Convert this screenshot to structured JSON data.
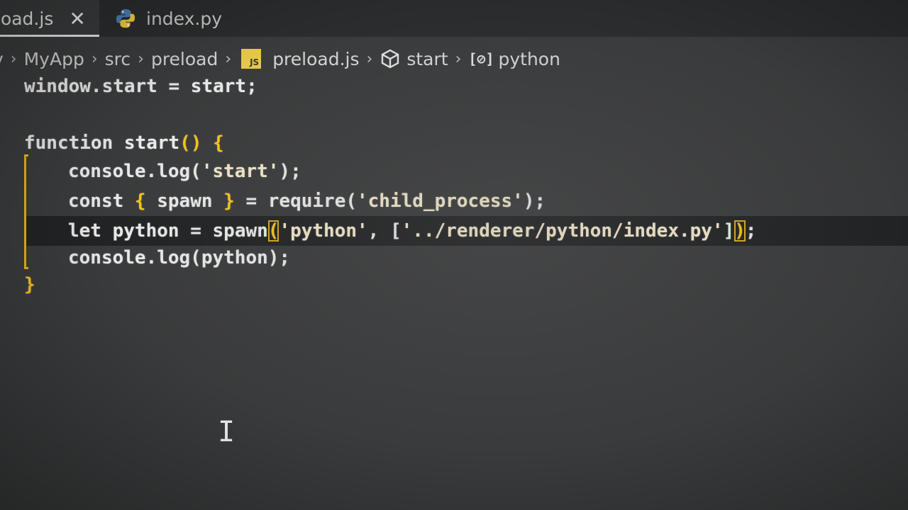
{
  "tabs": [
    {
      "label": "load.js",
      "active": true,
      "icon": "close-icon",
      "close_glyph": "✕"
    },
    {
      "label": "index.py",
      "active": false,
      "icon": "python-icon"
    }
  ],
  "breadcrumb": {
    "items": [
      "v",
      "MyApp",
      "src",
      "preload",
      "preload.js",
      "start",
      "python"
    ],
    "separator": "›",
    "js_badge": "JS",
    "var_glyph": "[⊘]"
  },
  "code": {
    "line1": {
      "a": "window.start = start;"
    },
    "line3": {
      "kw": "function ",
      "name": "start",
      "parens": "()",
      "space": " ",
      "brace": "{"
    },
    "line4": {
      "a": "console.log(",
      "str": "'start'",
      "b": ");"
    },
    "line5": {
      "kw": "const ",
      "lb": "{",
      "mid": " spawn ",
      "rb": "}",
      "eq": " = require(",
      "str": "'child_process'",
      "end": ");"
    },
    "line6": {
      "kw": "let ",
      "var": "python",
      "eq": " = spawn",
      "lp": "(",
      "s1": "'python'",
      "comma": ", [",
      "s2": "'../renderer/python/index.py'",
      "rbr": "]",
      "rp": ")",
      "end": ";"
    },
    "line7": {
      "a": "console.log(python);"
    },
    "line8": {
      "brace": "}"
    }
  },
  "colors": {
    "background": "#3a3b3c",
    "tabbar": "#2b2c2d",
    "accent_brace": "#f5c518",
    "current_line": "#222324"
  },
  "cursor_glyph": "I"
}
